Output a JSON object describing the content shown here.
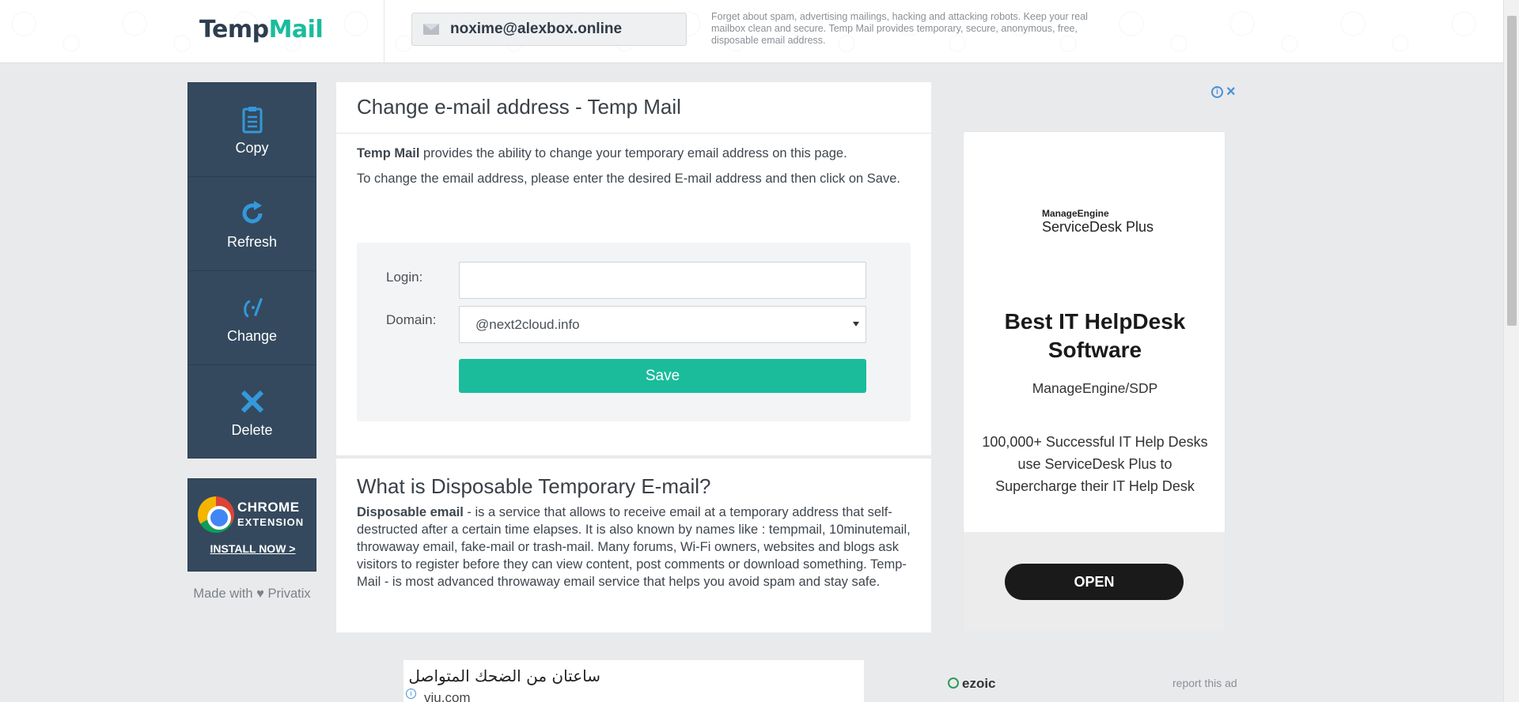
{
  "header": {
    "logo_temp": "Temp",
    "logo_mail": "Mail",
    "email": "noxime@alexbox.online",
    "description": "Forget about spam, advertising mailings, hacking and attacking robots. Keep your real mailbox clean and secure. Temp Mail provides temporary, secure, anonymous, free, disposable email address."
  },
  "sidebar": {
    "items": [
      {
        "label": "Copy",
        "icon": "clipboard-icon"
      },
      {
        "label": "Refresh",
        "icon": "refresh-icon"
      },
      {
        "label": "Change",
        "icon": "edit-icon"
      },
      {
        "label": "Delete",
        "icon": "close-icon"
      }
    ],
    "chrome": {
      "title": "CHROME",
      "subtitle": "EXTENSION",
      "install": "INSTALL NOW >"
    },
    "made_with": "Made with ♥ Privatix"
  },
  "main": {
    "title": "Change e-mail address - Temp Mail",
    "intro_bold": "Temp Mail",
    "intro_rest": " provides the ability to change your temporary email address on this page.",
    "instructions": "To change the email address, please enter the desired E-mail address and then click on Save.",
    "form": {
      "login_label": "Login:",
      "login_value": "",
      "domain_label": "Domain:",
      "domain_value": "@next2cloud.info",
      "save_label": "Save"
    },
    "what_title": "What is Disposable Temporary E-mail?",
    "what_bold": "Disposable email",
    "what_rest": " - is a service that allows to receive email at a temporary address that self-destructed after a certain time elapses. It is also known by names like : tempmail, 10minutemail, throwaway email, fake-mail or trash-mail. Many forums, Wi-Fi owners, websites and blogs ask visitors to register before they can view content, post comments or download something. Temp-Mail - is most advanced throwaway email service that helps you avoid spam and stay safe."
  },
  "ad": {
    "brand_top": "ManageEngine",
    "brand_product": "ServiceDesk Plus",
    "headline": "Best IT HelpDesk Software",
    "domain": "ManageEngine/SDP",
    "body": "100,000+ Successful IT Help Desks use ServiceDesk Plus to Supercharge their IT Help Desk",
    "cta": "OPEN",
    "ezoic": "ezoic",
    "report": "report this ad"
  },
  "bottom_ad": {
    "title": "ساعتان من الضحك المتواصل",
    "site": "viu.com"
  },
  "colors": {
    "accent": "#1abc9c",
    "sidebar": "#34495e",
    "icon_blue": "#3498db"
  }
}
